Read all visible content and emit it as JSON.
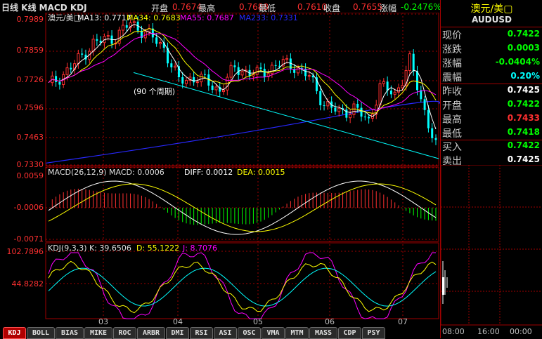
{
  "header": {
    "title": "日线 K线 MACD KDJ",
    "open_label": "开盘",
    "open_value": "0.7674",
    "high_label": "最高",
    "high_value": "0.7688",
    "low_label": "最低",
    "low_value": "0.7610",
    "close_label": "收盘",
    "close_value": "0.7655",
    "change_label": "涨幅",
    "change_value": "-0.2476%"
  },
  "main_chart": {
    "legend": [
      "澳元/美□",
      "MA13: 0.7717",
      "MA34: 0.7683",
      "MA55: 0.7687",
      "MA233: 0.7331"
    ],
    "annotation": "(90 个周期)",
    "yticks": [
      "0.7989",
      "0.7859",
      "0.7726",
      "0.7596",
      "0.7463",
      "0.7330"
    ],
    "colors": {
      "up": "#ff3030",
      "down": "#00ffff",
      "ma13": "#ffffff",
      "ma34": "#ffff00",
      "ma55": "#ff00ff",
      "ma233": "#2828ff",
      "trend": "#00ffff"
    }
  },
  "macd_chart": {
    "legend": [
      "MACD(26,12,9) MACD: 0.0006",
      "DIFF: 0.0012",
      "DEA: 0.0015"
    ],
    "yticks": [
      "0.0059",
      "-0.0006",
      "-0.0071"
    ]
  },
  "kdj_chart": {
    "legend": [
      "KDJ(9,3,3) K: 39.6506",
      "D: 55.1222",
      "J: 8.7076"
    ],
    "yticks": [
      "102.7896",
      "44.8282"
    ]
  },
  "x_axis": {
    "labels": [
      "03",
      "04",
      "05",
      "06",
      "07"
    ]
  },
  "quote_panel": {
    "title": "澳元/美▢",
    "symbol": "AUDUSD",
    "rows": [
      {
        "label": "现价",
        "value": "0.7422",
        "color": "#00ff00"
      },
      {
        "label": "涨跌",
        "value": "0.0003",
        "color": "#00ff00"
      },
      {
        "label": "涨幅",
        "value": "-0.0404%",
        "color": "#00ff00"
      },
      {
        "label": "震幅",
        "value": "0.20%",
        "color": "#00ffff"
      },
      {
        "label": "昨收",
        "value": "0.7425",
        "color": "#ffffff"
      },
      {
        "label": "开盘",
        "value": "0.7422",
        "color": "#00ff00"
      },
      {
        "label": "最高",
        "value": "0.7433",
        "color": "#ff3030"
      },
      {
        "label": "最低",
        "value": "0.7418",
        "color": "#00ff00"
      },
      {
        "label": "买入",
        "value": "0.7422",
        "color": "#00ff00"
      },
      {
        "label": "卖出",
        "value": "0.7425",
        "color": "#ffffff"
      }
    ],
    "time_labels": [
      "08:00",
      "16:00",
      "00:00"
    ]
  },
  "tabs": [
    "KDJ",
    "BOLL",
    "BIAS",
    "MIKE",
    "ROC",
    "ARBR",
    "DMI",
    "RSI",
    "ASI",
    "OSC",
    "VMA",
    "MTM",
    "MASS",
    "CDP",
    "PSY"
  ],
  "active_tab": "KDJ",
  "chart_data": {
    "type": "line",
    "x": [
      "03",
      "04",
      "05",
      "06",
      "07"
    ],
    "series": [
      {
        "name": "MA13",
        "values": [
          0.7717
        ]
      },
      {
        "name": "MA34",
        "values": [
          0.7683
        ]
      },
      {
        "name": "MA55",
        "values": [
          0.7687
        ]
      },
      {
        "name": "MA233",
        "values": [
          0.7331
        ]
      }
    ],
    "ylim": [
      0.733,
      0.7989
    ],
    "grid": true,
    "legend": "top-left"
  }
}
